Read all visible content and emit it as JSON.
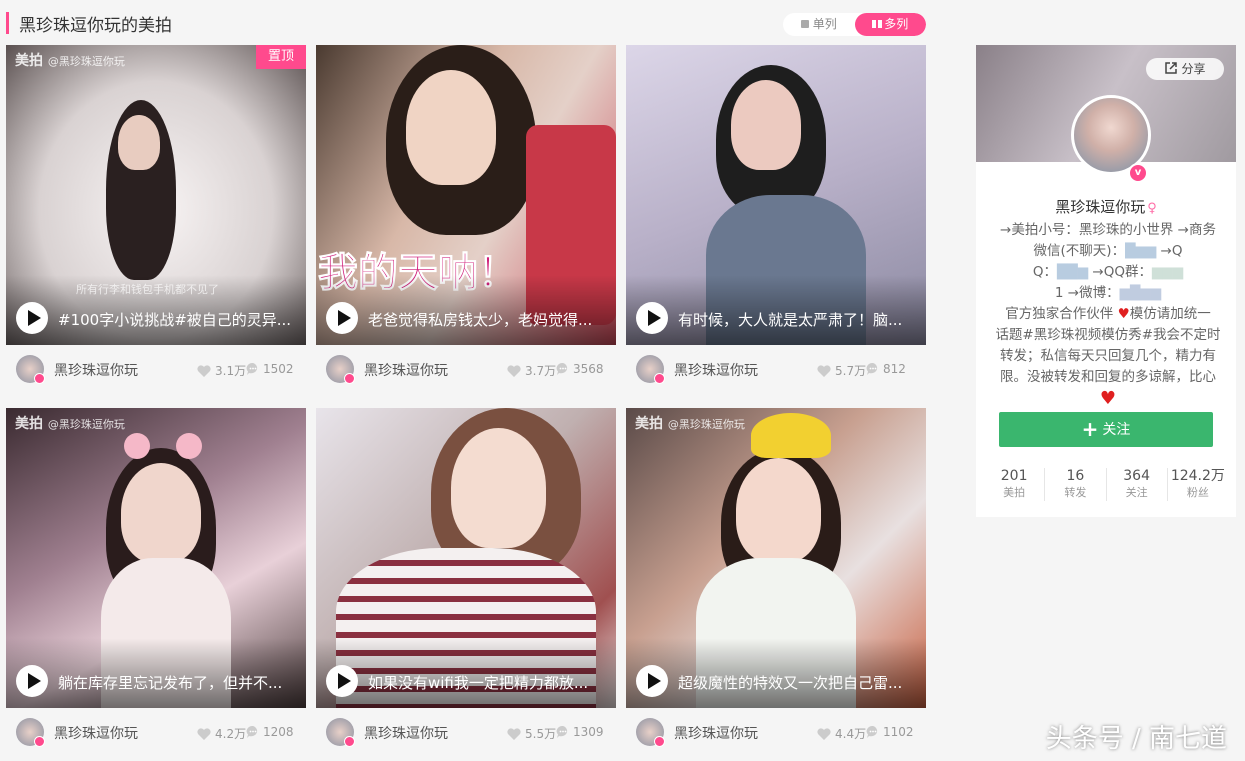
{
  "header": {
    "title": "黑珍珠逗你玩的美拍",
    "view_single": "单列",
    "view_multi": "多列",
    "accent_color": "#ff4a8d"
  },
  "videos": [
    {
      "watermark": "美拍",
      "watermark_handle": "@黑珍珠逗你玩",
      "pinned_label": "置顶",
      "subtitle": "所有行李和钱包手机都不见了",
      "caption": "#100字小说挑战#被自己的灵异...",
      "author": "黑珍珠逗你玩",
      "likes": "3.1万",
      "comments": "1502"
    },
    {
      "watermark": "",
      "watermark_handle": "",
      "overlay_text": "我的天呐！",
      "caption": "老爸觉得私房钱太少，老妈觉得...",
      "author": "黑珍珠逗你玩",
      "likes": "3.7万",
      "comments": "3568"
    },
    {
      "watermark": "",
      "watermark_handle": "",
      "caption": "有时候，大人就是太严肃了！脑...",
      "author": "黑珍珠逗你玩",
      "likes": "5.7万",
      "comments": "812"
    },
    {
      "watermark": "美拍",
      "watermark_handle": "@黑珍珠逗你玩",
      "caption": "躺在库存里忘记发布了，但并不...",
      "author": "黑珍珠逗你玩",
      "likes": "4.2万",
      "comments": "1208"
    },
    {
      "watermark": "",
      "watermark_handle": "",
      "caption": "如果没有wifi我一定把精力都放...",
      "author": "黑珍珠逗你玩",
      "likes": "5.5万",
      "comments": "1309"
    },
    {
      "watermark": "美拍",
      "watermark_handle": "@黑珍珠逗你玩",
      "caption": "超级魔性的特效又一次把自己雷...",
      "author": "黑珍珠逗你玩",
      "likes": "4.4万",
      "comments": "1102"
    }
  ],
  "profile": {
    "share_label": "分享",
    "name": "黑珍珠逗你玩",
    "gender_icon": "♀",
    "verified_icon": "v",
    "bio_lines": [
      "→美拍小号：黑珍珠的小世界 →商务",
      "微信(不聊天)：",
      "Q：",
      "1 →微博：",
      "官方独家合作伙伴",
      "模仿请加统一",
      "话题#黑珍珠视频模仿秀#我会不定时",
      "转发；私信每天只回复几个，精力有",
      "限。没被转发和回复的多谅解，比心"
    ],
    "bio_fragments": {
      "qq_group": "→QQ群：",
      "qq": "→Q"
    },
    "follow_label": "关注",
    "follow_color": "#3ab66e",
    "stats": [
      {
        "num": "201",
        "label": "美拍"
      },
      {
        "num": "16",
        "label": "转发"
      },
      {
        "num": "364",
        "label": "关注"
      },
      {
        "num": "124.2万",
        "label": "粉丝"
      }
    ]
  },
  "watermark_text": "头条号 / 南七道"
}
